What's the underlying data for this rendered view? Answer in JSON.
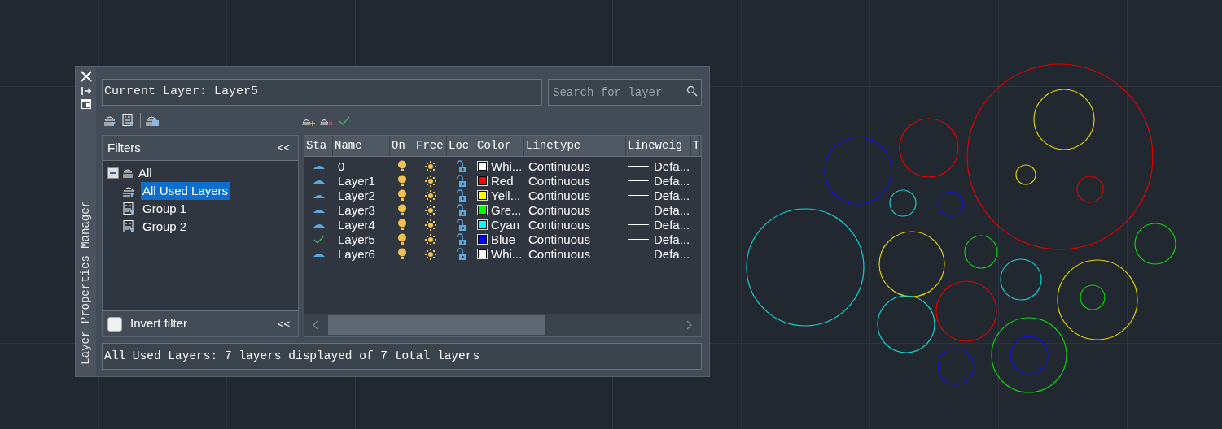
{
  "panel": {
    "title": "Layer Properties Manager"
  },
  "current_layer": "Current Layer: Layer5",
  "search": {
    "placeholder": "Search for layer"
  },
  "filters": {
    "title": "Filters",
    "collapse_button": "<<",
    "tree": [
      {
        "label": "All",
        "expanded": true,
        "selected": false,
        "children": [
          {
            "label": "All Used Layers",
            "selected": true
          },
          {
            "label": "Group 1",
            "selected": false
          },
          {
            "label": "Group 2",
            "selected": false
          }
        ]
      }
    ],
    "invert_filter": {
      "label": "Invert filter",
      "checked": false
    },
    "footer_button": "<<"
  },
  "table": {
    "columns": [
      "Sta",
      "Name",
      "On",
      "Free",
      "Loc",
      "Color",
      "Linetype",
      "Lineweig",
      "T"
    ],
    "rows": [
      {
        "current": false,
        "name": "0",
        "on": true,
        "frozen": false,
        "locked": false,
        "color": "#ffffff",
        "color_name": "Whi...",
        "linetype": "Continuous",
        "lineweight": "Defa..."
      },
      {
        "current": false,
        "name": "Layer1",
        "on": true,
        "frozen": false,
        "locked": false,
        "color": "#ff0000",
        "color_name": "Red",
        "linetype": "Continuous",
        "lineweight": "Defa..."
      },
      {
        "current": false,
        "name": "Layer2",
        "on": true,
        "frozen": false,
        "locked": false,
        "color": "#ffff00",
        "color_name": "Yell...",
        "linetype": "Continuous",
        "lineweight": "Defa..."
      },
      {
        "current": false,
        "name": "Layer3",
        "on": true,
        "frozen": false,
        "locked": false,
        "color": "#00ff00",
        "color_name": "Gre...",
        "linetype": "Continuous",
        "lineweight": "Defa..."
      },
      {
        "current": false,
        "name": "Layer4",
        "on": true,
        "frozen": false,
        "locked": false,
        "color": "#00ffff",
        "color_name": "Cyan",
        "linetype": "Continuous",
        "lineweight": "Defa..."
      },
      {
        "current": true,
        "name": "Layer5",
        "on": true,
        "frozen": false,
        "locked": false,
        "color": "#0000ff",
        "color_name": "Blue",
        "linetype": "Continuous",
        "lineweight": "Defa..."
      },
      {
        "current": false,
        "name": "Layer6",
        "on": true,
        "frozen": false,
        "locked": false,
        "color": "#ffffff",
        "color_name": "Whi...",
        "linetype": "Continuous",
        "lineweight": "Defa..."
      }
    ]
  },
  "status_bar": "All Used Layers: 7 layers displayed of 7 total layers"
}
